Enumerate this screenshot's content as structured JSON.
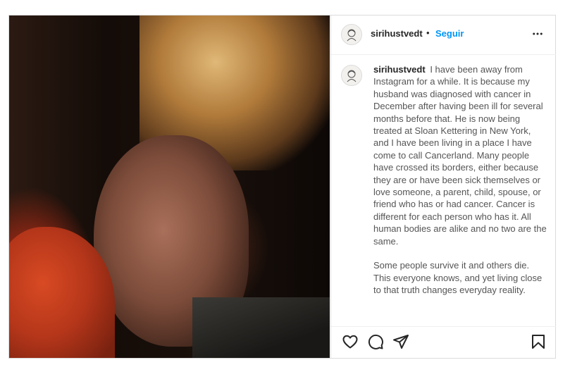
{
  "post": {
    "username": "sirihustvedt",
    "separator": "•",
    "follow_label": "Seguir",
    "media": {
      "description_icon": "photo"
    },
    "caption": {
      "username": "sirihustvedt",
      "paragraph1": "I have been away from Instagram for a while. It is because my husband was diagnosed with cancer in December after having been ill for several months before that. He is now being treated at Sloan Kettering in New York, and I have been living in a place I have come to call Cancerland. Many people have crossed its borders, either because they are or have been sick themselves or love someone, a parent, child, spouse, or friend who has or had cancer. Cancer is different for each person who has it. All human bodies are alike and no two are the same.",
      "paragraph2": "Some people survive it and others die. This everyone knows, and yet living close to that truth changes everyday reality."
    },
    "icons": {
      "more": "more-horizontal-icon",
      "like": "heart-icon",
      "comment": "comment-icon",
      "share": "share-icon",
      "save": "bookmark-icon"
    },
    "colors": {
      "accent": "#0095f6",
      "text": "#262626",
      "border": "#dbdbdb"
    }
  }
}
